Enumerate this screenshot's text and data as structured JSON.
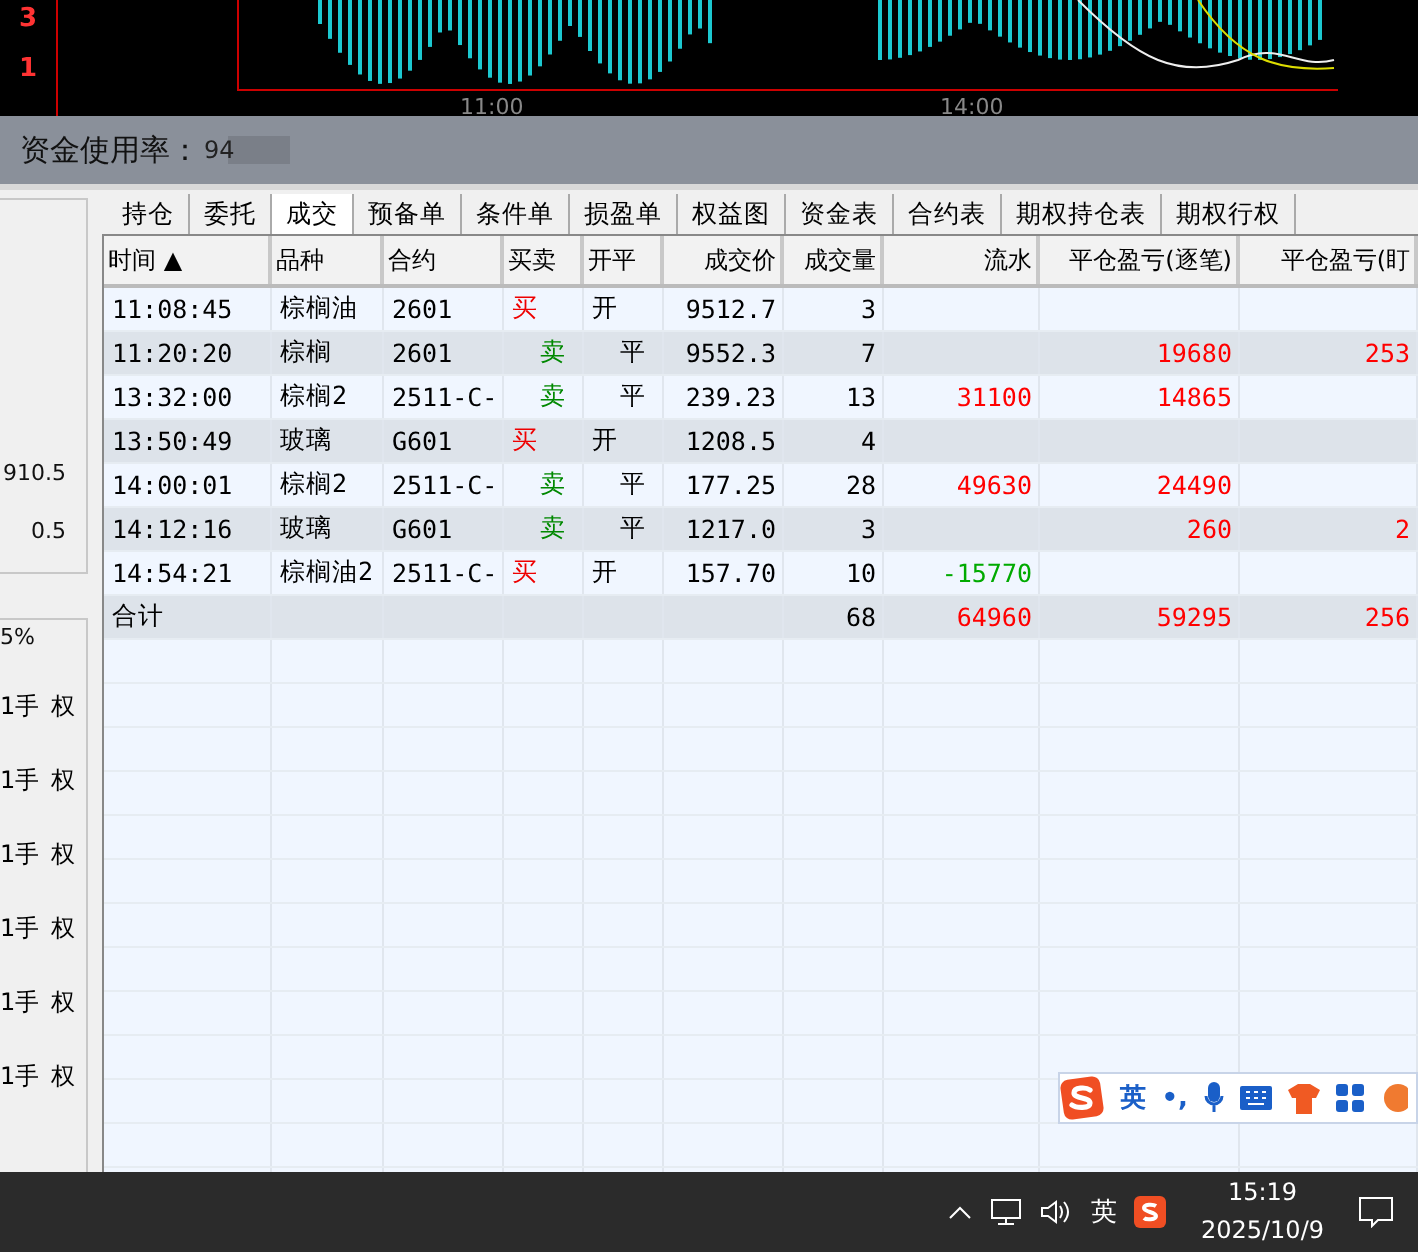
{
  "chart": {
    "axis_numbers": [
      "3",
      "1"
    ],
    "time_labels": [
      "11:00",
      "14:00"
    ]
  },
  "fund_bar": {
    "label": "资金使用率：",
    "value": "94"
  },
  "side_panel": {
    "values": [
      "910.5",
      "0.5"
    ],
    "ratio": "5%",
    "rows": [
      {
        "qty": "1手",
        "tag": "权"
      },
      {
        "qty": "1手",
        "tag": "权"
      },
      {
        "qty": "1手",
        "tag": "权"
      },
      {
        "qty": "1手",
        "tag": "权"
      },
      {
        "qty": "1手",
        "tag": "权"
      },
      {
        "qty": "1手",
        "tag": "权"
      }
    ]
  },
  "tabs": [
    {
      "label": "持仓",
      "selected": false
    },
    {
      "label": "委托",
      "selected": false
    },
    {
      "label": "成交",
      "selected": true
    },
    {
      "label": "预备单",
      "selected": false
    },
    {
      "label": "条件单",
      "selected": false
    },
    {
      "label": "损盈单",
      "selected": false
    },
    {
      "label": "权益图",
      "selected": false
    },
    {
      "label": "资金表",
      "selected": false
    },
    {
      "label": "合约表",
      "selected": false
    },
    {
      "label": "期权持仓表",
      "selected": false
    },
    {
      "label": "期权行权",
      "selected": false
    }
  ],
  "table": {
    "columns": [
      "时间 ▲",
      "品种",
      "合约",
      "买卖",
      "开平",
      "成交价",
      "成交量",
      "流水",
      "平仓盈亏(逐笔)",
      "平仓盈亏(盯"
    ],
    "rows": [
      {
        "time": "11:08:45",
        "product": "棕榈油",
        "contract": "2601",
        "side": {
          "kind": "buy",
          "text": "买"
        },
        "offset": {
          "kind": "open",
          "text": "开"
        },
        "price": "9512.7",
        "qty": "3",
        "flow": null,
        "pnl_trade": null,
        "pnl_mark": null
      },
      {
        "time": "11:20:20",
        "product": "棕榈",
        "contract": "2601",
        "side": {
          "kind": "sell",
          "text": "卖"
        },
        "offset": {
          "kind": "close",
          "text": "平"
        },
        "price": "9552.3",
        "qty": "7",
        "flow": null,
        "pnl_trade": {
          "text": "19680",
          "color": "#ff0000"
        },
        "pnl_mark": {
          "text": "253",
          "color": "#ff0000"
        }
      },
      {
        "time": "13:32:00",
        "product": "棕榈2",
        "contract": "2511-C-",
        "side": {
          "kind": "sell",
          "text": "卖"
        },
        "offset": {
          "kind": "close",
          "text": "平"
        },
        "price": "239.23",
        "qty": "13",
        "flow": {
          "text": "31100",
          "color": "#ff0000"
        },
        "pnl_trade": {
          "text": "14865",
          "color": "#ff0000"
        },
        "pnl_mark": null
      },
      {
        "time": "13:50:49",
        "product": "玻璃",
        "contract": "G601",
        "side": {
          "kind": "buy",
          "text": "买"
        },
        "offset": {
          "kind": "open",
          "text": "开"
        },
        "price": "1208.5",
        "qty": "4",
        "flow": null,
        "pnl_trade": null,
        "pnl_mark": null
      },
      {
        "time": "14:00:01",
        "product": "棕榈2",
        "contract": "2511-C-",
        "side": {
          "kind": "sell",
          "text": "卖"
        },
        "offset": {
          "kind": "close",
          "text": "平"
        },
        "price": "177.25",
        "qty": "28",
        "flow": {
          "text": "49630",
          "color": "#ff0000"
        },
        "pnl_trade": {
          "text": "24490",
          "color": "#ff0000"
        },
        "pnl_mark": null
      },
      {
        "time": "14:12:16",
        "product": "玻璃",
        "contract": "G601",
        "side": {
          "kind": "sell",
          "text": "卖"
        },
        "offset": {
          "kind": "close",
          "text": "平"
        },
        "price": "1217.0",
        "qty": "3",
        "flow": null,
        "pnl_trade": {
          "text": "260",
          "color": "#ff0000"
        },
        "pnl_mark": {
          "text": "2",
          "color": "#ff0000"
        }
      },
      {
        "time": "14:54:21",
        "product": "棕榈油2",
        "contract": "2511-C-",
        "side": {
          "kind": "buy",
          "text": "买"
        },
        "offset": {
          "kind": "open",
          "text": "开"
        },
        "price": "157.70",
        "qty": "10",
        "flow": {
          "text": "-15770",
          "color": "#00aa00"
        },
        "pnl_trade": null,
        "pnl_mark": null
      }
    ],
    "total": {
      "label": "合计",
      "qty": "68",
      "flow": {
        "text": "64960",
        "color": "#ff0000"
      },
      "pnl_trade": {
        "text": "59295",
        "color": "#ff0000"
      },
      "pnl_mark": {
        "text": "256",
        "color": "#ff0000"
      }
    }
  },
  "ime_bar": {
    "mode": "英",
    "punct": "•,"
  },
  "taskbar": {
    "language": "英",
    "time": "15:19",
    "date": "2025/10/9"
  }
}
